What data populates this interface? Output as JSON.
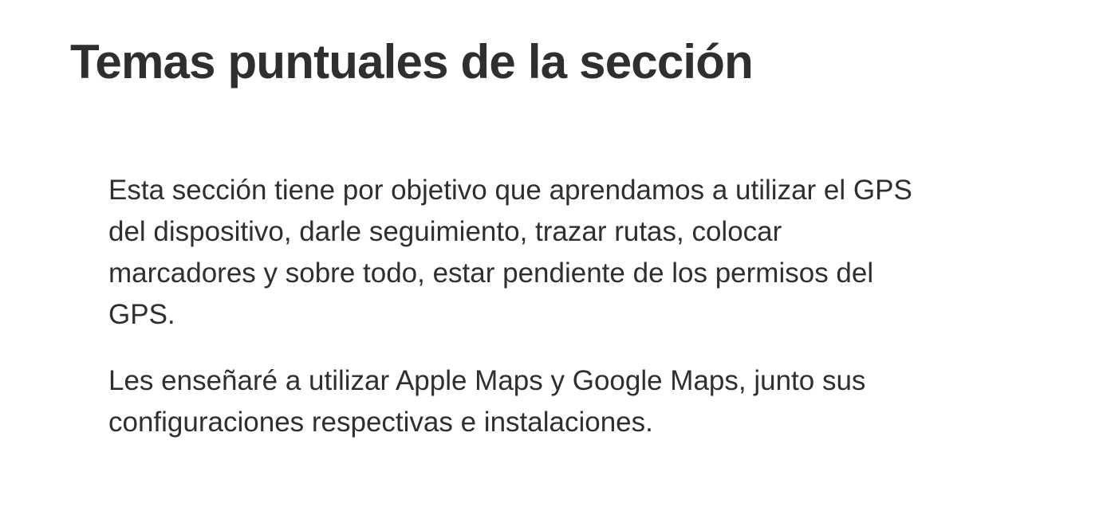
{
  "section": {
    "title": "Temas puntuales de la sección",
    "paragraphs": [
      {
        "lines": [
          "Esta sección tiene por objetivo que aprendamos a utilizar el GPS",
          "del dispositivo, darle seguimiento, trazar rutas, colocar",
          "marcadores y sobre todo, estar pendiente de los permisos del",
          "GPS."
        ]
      },
      {
        "lines": [
          "Les enseñaré a utilizar Apple Maps y Google Maps, junto sus",
          "configuraciones respectivas e instalaciones."
        ]
      }
    ]
  }
}
